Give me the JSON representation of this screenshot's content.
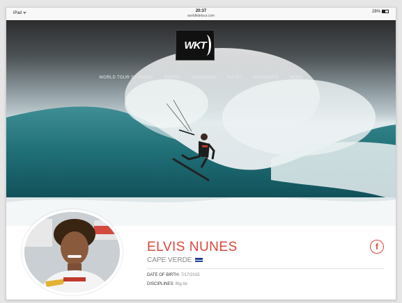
{
  "status_bar": {
    "device": "iPad ᯤ",
    "time": "20:37",
    "url": "worldkitetour.com",
    "battery": "28%"
  },
  "header": {
    "logo_text": "WKT",
    "nav": [
      "WORLD TOUR SCHOOLS",
      "RIDERS",
      "RANKINGS",
      "RULES",
      "SPONSORS",
      "NEWS"
    ]
  },
  "profile": {
    "name": "ELVIS NUNES",
    "country": "CAPE VERDE",
    "dob_label": "DATE OF BIRTH:",
    "dob_value": "7/17/2015",
    "disciplines_label": "DISCIPLINES:",
    "disciplines_value": "Big Air",
    "social_icon": "f"
  },
  "colors": {
    "accent": "#d9473a",
    "flag": "#1e3f9a"
  },
  "icons": [
    "wifi-icon",
    "battery-icon",
    "facebook-icon",
    "flag-icon"
  ]
}
